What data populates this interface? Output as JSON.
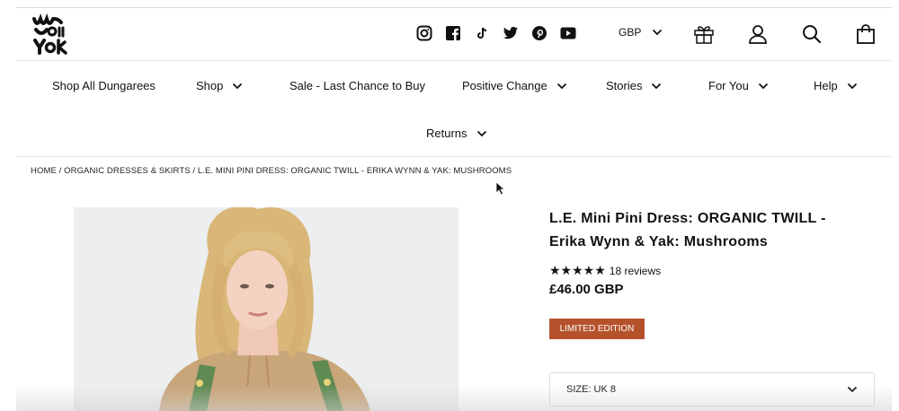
{
  "header": {
    "logo_alt": "Lucy & Yak",
    "social_icons": [
      "instagram-icon",
      "facebook-icon",
      "tiktok-icon",
      "twitter-icon",
      "pinterest-icon",
      "youtube-icon"
    ],
    "currency": "GBP",
    "icons": [
      "gift-icon",
      "account-icon",
      "search-icon",
      "cart-icon"
    ]
  },
  "nav": {
    "items": [
      {
        "label": "Shop All Dungarees"
      },
      {
        "label": "Shop"
      },
      {
        "label": "Sale - Last Chance to Buy"
      },
      {
        "label": "Positive Change"
      },
      {
        "label": "Stories"
      },
      {
        "label": "For You"
      },
      {
        "label": "Help"
      },
      {
        "label": "Returns"
      }
    ]
  },
  "breadcrumb": "HOME / ORGANIC DRESSES & SKIRTS / L.E. MINI PINI DRESS: ORGANIC TWILL - ERIKA WYNN & YAK: MUSHROOMS",
  "product": {
    "title": "L.E. Mini Pini Dress: ORGANIC TWILL - Erika Wynn & Yak: Mushrooms",
    "stars": "★★★★★",
    "rating_value": 5,
    "reviews": "18 reviews",
    "price": "£46.00 GBP",
    "badge": "LIMITED EDITION",
    "size_label": "SIZE: UK 8"
  },
  "colors": {
    "badge": "#b5522c",
    "text": "#111111"
  }
}
